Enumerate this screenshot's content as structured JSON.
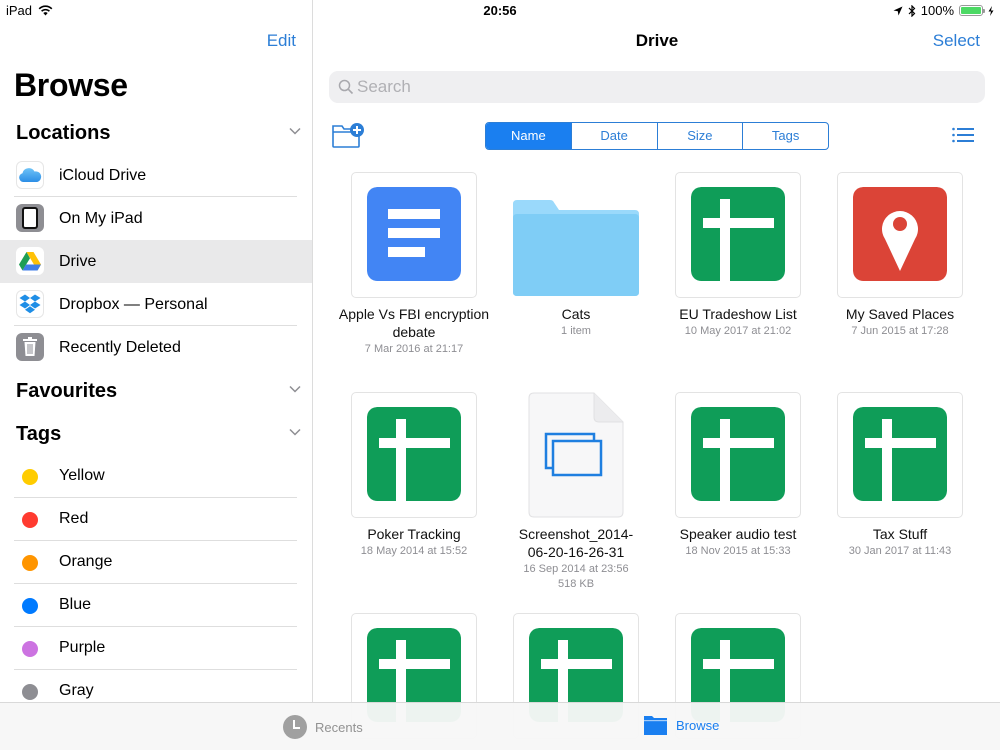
{
  "status_bar": {
    "device": "iPad",
    "time": "20:56",
    "battery": "100%",
    "battery_level": 1.0
  },
  "sidebar": {
    "edit_label": "Edit",
    "title": "Browse",
    "sections": {
      "locations": "Locations",
      "favourites": "Favourites",
      "tags": "Tags"
    },
    "locations": [
      {
        "label": "iCloud Drive",
        "icon": "icloud-icon",
        "selected": false
      },
      {
        "label": "On My iPad",
        "icon": "ipad-icon",
        "selected": false
      },
      {
        "label": "Drive",
        "icon": "google-drive-icon",
        "selected": true
      },
      {
        "label": "Dropbox — Personal",
        "icon": "dropbox-icon",
        "selected": false
      },
      {
        "label": "Recently Deleted",
        "icon": "trash-icon",
        "selected": false
      }
    ],
    "tags": [
      {
        "label": "Yellow",
        "color": "#ffcc00"
      },
      {
        "label": "Red",
        "color": "#ff3b30"
      },
      {
        "label": "Orange",
        "color": "#ff9500"
      },
      {
        "label": "Blue",
        "color": "#007aff"
      },
      {
        "label": "Purple",
        "color": "#cc73e1"
      },
      {
        "label": "Gray",
        "color": "#8e8e93"
      }
    ]
  },
  "main": {
    "title": "Drive",
    "select_label": "Select",
    "search_placeholder": "Search",
    "sort_options": [
      "Name",
      "Date",
      "Size",
      "Tags"
    ],
    "sort_active": "Name",
    "files": [
      {
        "name": "Apple Vs FBI encryption debate",
        "meta": [
          "7 Mar 2016 at 21:17"
        ],
        "type": "doc"
      },
      {
        "name": "Cats",
        "meta": [
          "1 item"
        ],
        "type": "folder"
      },
      {
        "name": "EU Tradeshow List",
        "meta": [
          "10 May 2017 at 21:02"
        ],
        "type": "sheet"
      },
      {
        "name": "My Saved Places",
        "meta": [
          "7 Jun 2015 at 17:28"
        ],
        "type": "maps"
      },
      {
        "name": "Poker Tracking",
        "meta": [
          "18 May 2014 at 15:52"
        ],
        "type": "sheet"
      },
      {
        "name": "Screenshot_2014-06-20-16-26-31",
        "meta": [
          "16 Sep 2014 at 23:56",
          "518 KB"
        ],
        "type": "image"
      },
      {
        "name": "Speaker audio test",
        "meta": [
          "18 Nov 2015 at 15:33"
        ],
        "type": "sheet"
      },
      {
        "name": "Tax Stuff",
        "meta": [
          "30 Jan 2017 at 11:43"
        ],
        "type": "sheet"
      },
      {
        "name": "",
        "meta": [],
        "type": "sheet"
      },
      {
        "name": "",
        "meta": [],
        "type": "sheet"
      },
      {
        "name": "",
        "meta": [],
        "type": "sheet"
      }
    ]
  },
  "tabbar": {
    "recents": "Recents",
    "browse": "Browse",
    "active": "Browse"
  },
  "colors": {
    "accent": "#2c7ed6",
    "active_segment": "#1a7ff0",
    "docs_blue": "#4285f4",
    "sheets_green": "#0f9d58",
    "maps_red": "#db4437",
    "folder_blue": "#80cff8"
  }
}
